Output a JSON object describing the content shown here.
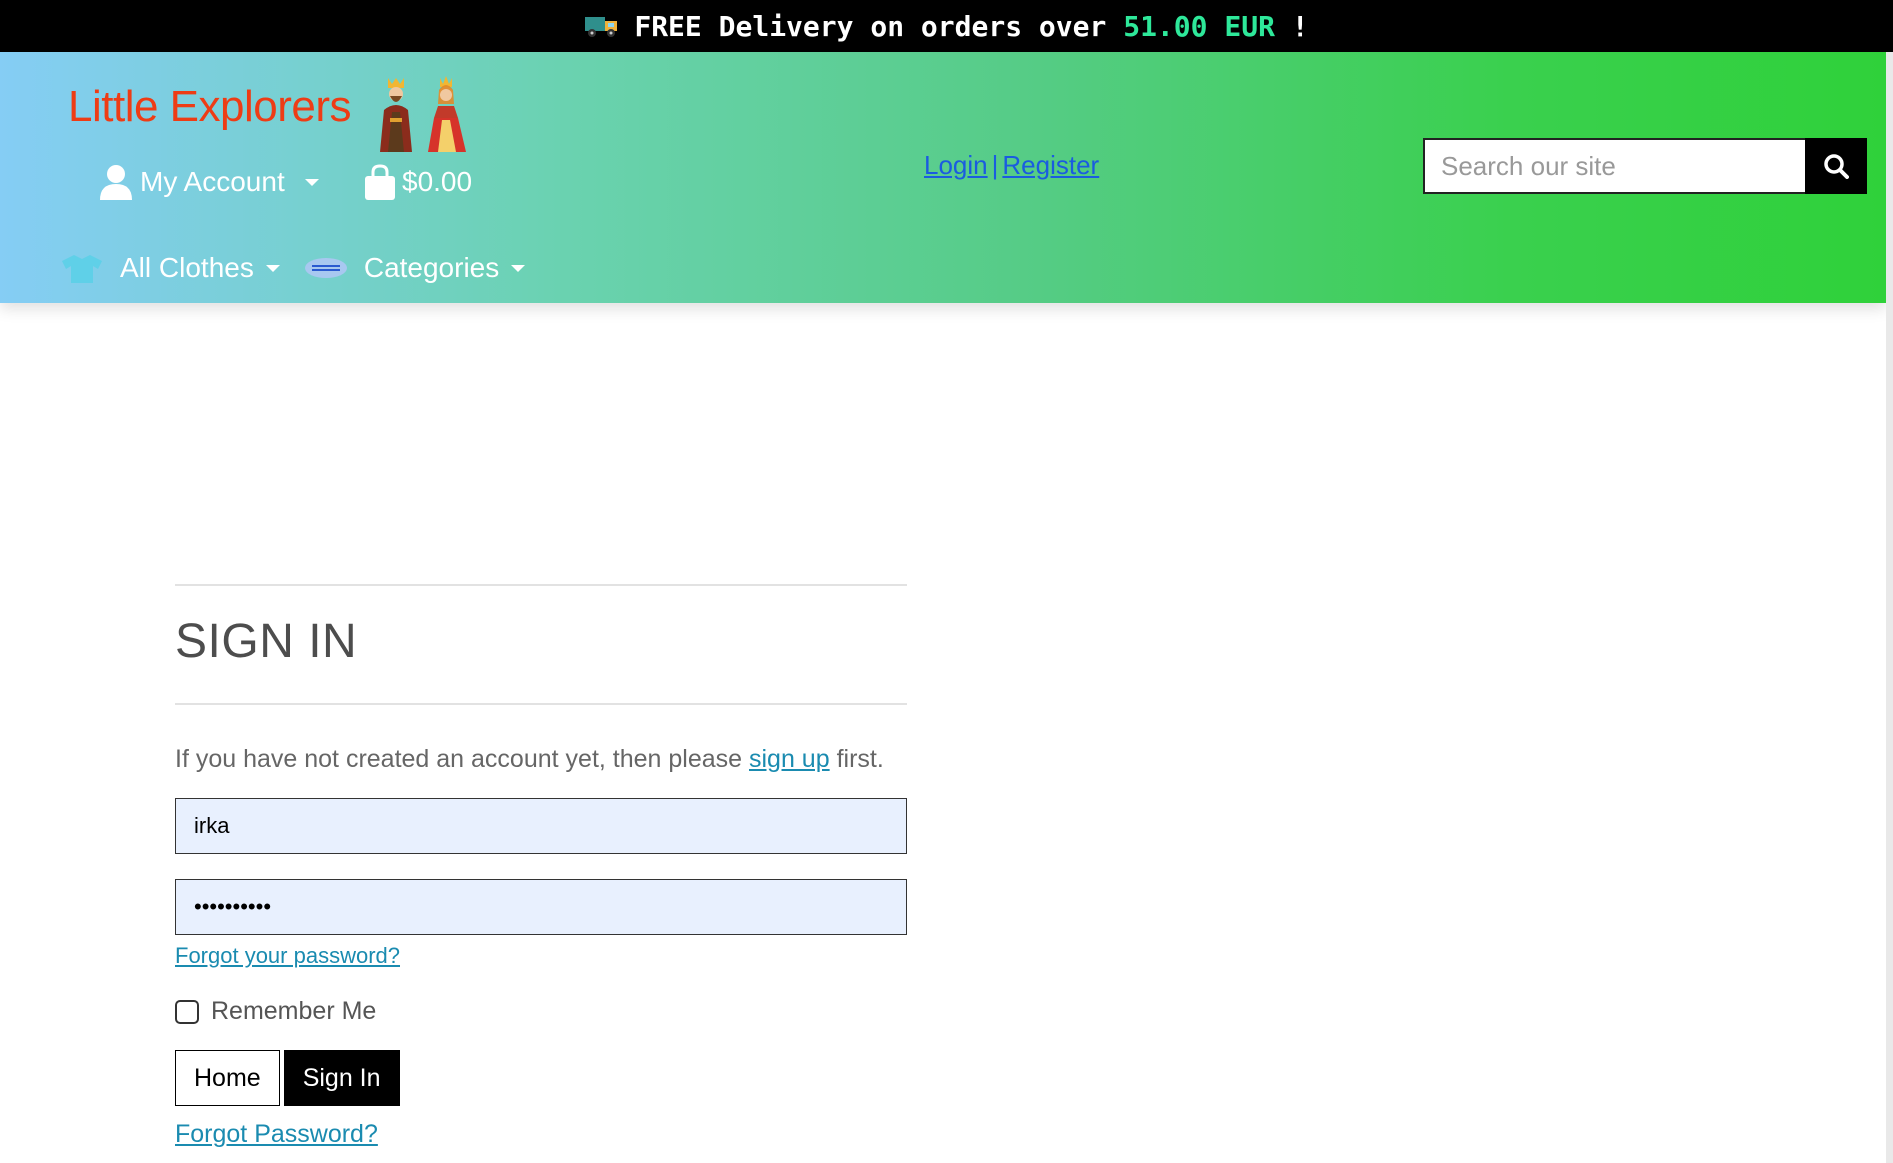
{
  "banner": {
    "text_prefix": "FREE Delivery on orders over ",
    "amount": "51.00 EUR",
    "text_suffix": " !",
    "accent_color": "#2ee89a",
    "icon": "delivery-truck-icon"
  },
  "header": {
    "logo": "Little Explorers",
    "logo_color": "#ee3c15",
    "account_label": "My Account",
    "cart_total": "$0.00",
    "login": "Login",
    "separator": "|",
    "register": "Register",
    "search_placeholder": "Search our site",
    "nav": [
      {
        "label": "All Clothes",
        "icon": "tshirt-icon"
      },
      {
        "label": "Categories",
        "icon": "categories-icon"
      }
    ]
  },
  "signin": {
    "title": "SIGN IN",
    "intro_before": "If you have not created an account yet, then please ",
    "intro_link": "sign up",
    "intro_after": " first.",
    "username_value": "irka",
    "password_value": "••••••••••",
    "forgot_password_link": "Forgot your password?",
    "remember_label": "Remember Me",
    "home_button": "Home",
    "signin_button": "Sign In",
    "forgot_password_bottom": "Forgot Password?"
  }
}
